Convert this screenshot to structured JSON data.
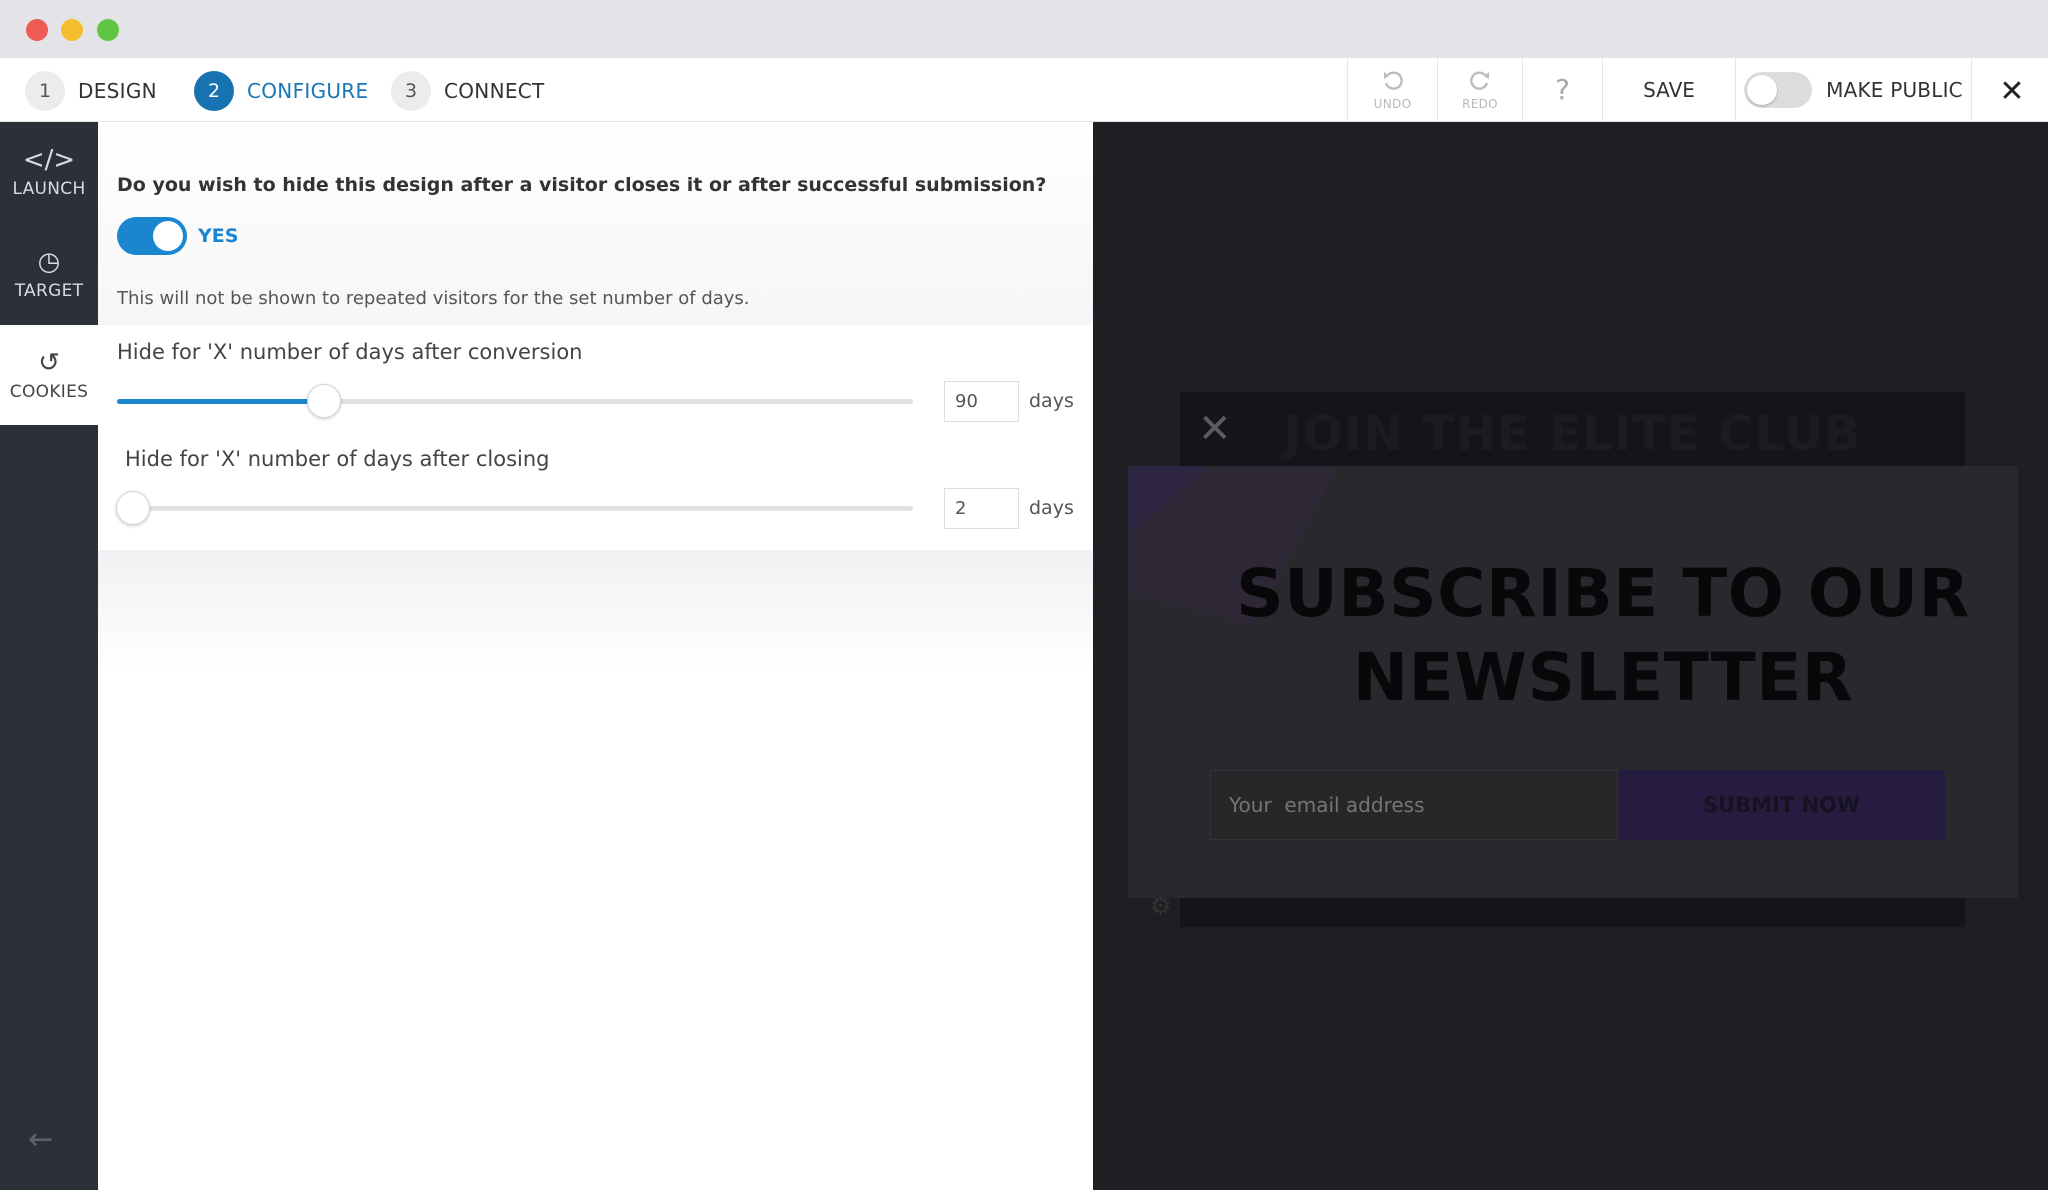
{
  "steps": [
    {
      "num": "1",
      "label": "DESIGN"
    },
    {
      "num": "2",
      "label": "CONFIGURE"
    },
    {
      "num": "3",
      "label": "CONNECT"
    }
  ],
  "toolbar": {
    "undo_label": "UNDO",
    "redo_label": "REDO",
    "help_icon": "?",
    "save_label": "SAVE",
    "public_label": "MAKE PUBLIC",
    "close_icon": "✕"
  },
  "sidebar": {
    "items": [
      {
        "icon": "</>",
        "label": "LAUNCH"
      },
      {
        "icon": "◷",
        "label": "TARGET"
      },
      {
        "icon": "↺",
        "label": "COOKIES"
      }
    ],
    "back_icon": "←"
  },
  "config": {
    "question": "Do you wish to hide this design after a visitor closes it or after successful submission?",
    "toggle_label": "YES",
    "note": "This will not be shown to repeated visitors for the set number of days.",
    "conversion": {
      "label": "Hide for 'X' number of days after conversion",
      "value": "90",
      "unit": "days",
      "fraction": 0.26
    },
    "closing": {
      "label": "Hide for 'X' number of days after closing",
      "value": "2",
      "unit": "days",
      "fraction": 0.02
    }
  },
  "preview": {
    "back_title": "JOIN THE ELITE CLUB",
    "back_close": "✕",
    "headline_line1": "SUBSCRIBE TO OUR",
    "headline_line2": "NEWSLETTER",
    "email_placeholder": "Your  email address",
    "submit_label": "SUBMIT NOW",
    "gear_icon": "⚙"
  },
  "colors": {
    "accent": "#1a86d0",
    "sidebar_bg": "#2b3039",
    "preview_bg": "#1d1f23"
  }
}
